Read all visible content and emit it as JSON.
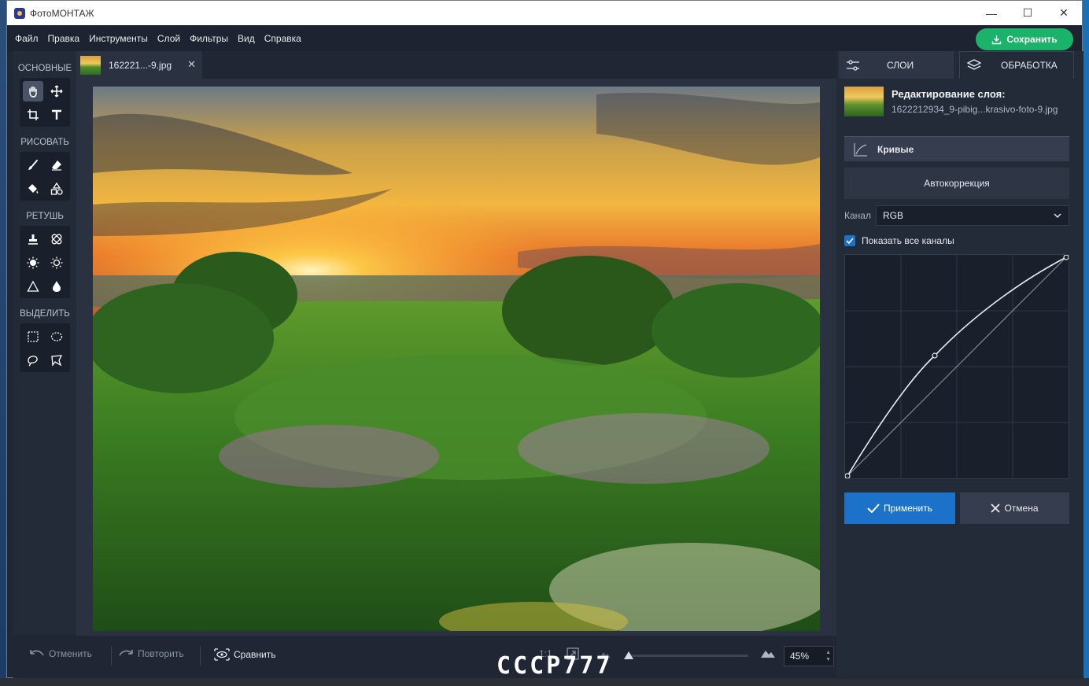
{
  "window": {
    "title": "ФотоМОНТАЖ",
    "minimize": "—",
    "maximize": "☐",
    "close": "✕"
  },
  "menu": [
    "Файл",
    "Правка",
    "Инструменты",
    "Слой",
    "Фильтры",
    "Вид",
    "Справка"
  ],
  "save_button": "Сохранить",
  "toolbar": {
    "sections": [
      "ОСНОВНЫЕ",
      "РИСОВАТЬ",
      "РЕТУШЬ",
      "ВЫДЕЛИТЬ"
    ]
  },
  "document_tab": {
    "label": "162221...-9.jpg",
    "close": "✕"
  },
  "bottom": {
    "undo": "Отменить",
    "redo": "Повторить",
    "compare": "Сравнить",
    "ratio": "1:1",
    "zoom": "45%"
  },
  "watermark": "СССР777",
  "right_panel": {
    "tab_layers": "СЛОИ",
    "tab_processing": "ОБРАБОТКА",
    "layer_title": "Редактирование слоя:",
    "layer_file": "1622212934_9-pibig...krasivo-foto-9.jpg",
    "curves_label": "Кривые",
    "autocorrect_label": "Автокоррекция",
    "channel_label": "Канал",
    "channel_value": "RGB",
    "show_all_channels": "Показать все каналы",
    "apply": "Применить",
    "cancel": "Отмена"
  },
  "colors": {
    "accent_green": "#1bb36a",
    "accent_blue": "#1c72c9",
    "panel_bg": "#232a38"
  }
}
